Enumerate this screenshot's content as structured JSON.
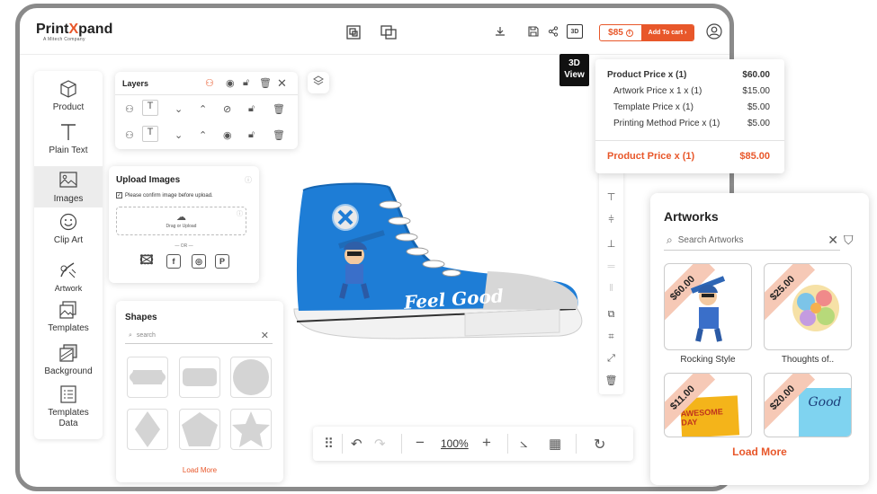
{
  "brand": {
    "name_prefix": "Print",
    "name_accent": "X",
    "name_suffix": "pand",
    "tagline": "A Mitech Company",
    "accent_color": "#e8572a"
  },
  "topbar": {
    "price": "$85",
    "add_to_cart": "Add To cart",
    "tooltip_3d_line1": "3D",
    "tooltip_3d_line2": "View",
    "btn_3d": "3D"
  },
  "sidebar": {
    "items": [
      {
        "label": "Product",
        "icon": "cube-icon"
      },
      {
        "label": "Plain Text",
        "icon": "text-icon"
      },
      {
        "label": "Images",
        "icon": "image-icon"
      },
      {
        "label": "Clip Art",
        "icon": "smiley-icon"
      },
      {
        "label": "Artwork",
        "icon": "palette-icon"
      },
      {
        "label": "Templates",
        "icon": "templates-icon"
      },
      {
        "label": "Background",
        "icon": "background-icon"
      },
      {
        "label": "Templates Data",
        "icon": "template-data-icon"
      }
    ],
    "active": "Images"
  },
  "layers": {
    "title": "Layers"
  },
  "upload": {
    "title": "Upload Images",
    "confirm": "Please confirm image before upload.",
    "drop": "Drag or Upload",
    "or": "OR"
  },
  "shapes": {
    "title": "Shapes",
    "search_placeholder": "search",
    "load_more": "Load More"
  },
  "canvas": {
    "zoom": "100%",
    "shoe_text": "Feel Good"
  },
  "price_breakdown": {
    "rows": [
      {
        "label": "Product Price x (1)",
        "value": "$60.00"
      },
      {
        "label": "Artwork Price x 1 x (1)",
        "value": "$15.00"
      },
      {
        "label": "Template Price x (1)",
        "value": "$5.00"
      },
      {
        "label": "Printing Method Price x (1)",
        "value": "$5.00"
      }
    ],
    "total_label": "Product Price x (1)",
    "total_value": "$85.00"
  },
  "artworks": {
    "title": "Artworks",
    "search_placeholder": "Search Artworks",
    "items": [
      {
        "name": "Rocking Style",
        "price": "$60.00"
      },
      {
        "name": "Thoughts of..",
        "price": "$25.00"
      },
      {
        "name": "",
        "price": "$11.00",
        "art_text": "AWESOME DAY"
      },
      {
        "name": "",
        "price": "$20.00",
        "art_text": "Good"
      }
    ],
    "load_more": "Load More"
  }
}
